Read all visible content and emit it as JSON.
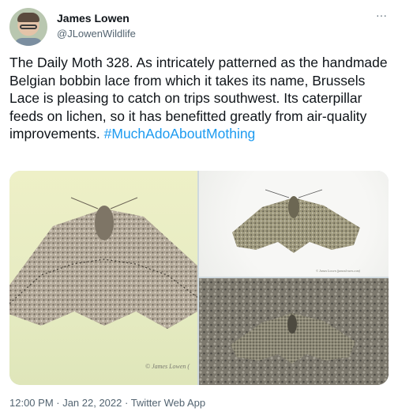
{
  "author": {
    "display_name": "James Lowen",
    "handle": "@JLowenWildlife"
  },
  "more_icon": "···",
  "tweet": {
    "text": "The Daily Moth 328. As intricately patterned as the handmade Belgian bobbin lace from which it takes its name, Brussels Lace is pleasing to catch on trips southwest. Its caterpillar feeds on lichen, so it has benefitted greatly from air-quality improvements.",
    "hashtag": "#MuchAdoAboutMothing"
  },
  "media": {
    "photo_1_credit": "© James Lowen (",
    "photo_2_credit": "© James Lowen (jameslowen.com)"
  },
  "meta": {
    "timestamp": "12:00 PM · Jan 22, 2022 · Twitter Web App"
  }
}
